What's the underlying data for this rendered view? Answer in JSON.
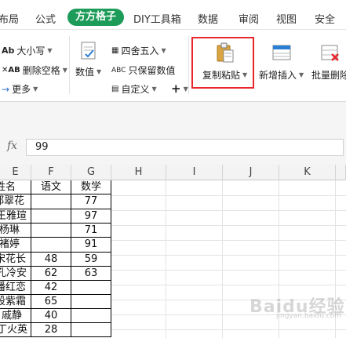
{
  "menu": {
    "tabs": [
      "布局",
      "公式",
      "方方格子",
      "DIY工具箱",
      "数据",
      "审阅",
      "视图",
      "安全"
    ],
    "active_tab": "方方格子"
  },
  "ribbon": {
    "uppercase": "大小写",
    "remove_spaces": "删除空格",
    "more": "更多",
    "numeric": "数值",
    "round": "四舍五入",
    "keep_numeric": "只保留数值",
    "custom": "自定义",
    "plus": "+",
    "copy_paste": "复制粘贴",
    "add_insert": "新增插入",
    "batch_delete": "批量删除"
  },
  "formula_bar": {
    "fx": "fx",
    "value": "99"
  },
  "columns": [
    "E",
    "F",
    "G",
    "H",
    "I",
    "J",
    "K"
  ],
  "rows": [
    {
      "name": "姓名",
      "chinese": "语文",
      "math": "数学"
    },
    {
      "name": "郑翠花",
      "chinese": "",
      "math": "77"
    },
    {
      "name": "王雅瑄",
      "chinese": "",
      "math": "97"
    },
    {
      "name": "杨琳",
      "chinese": "",
      "math": "71"
    },
    {
      "name": "褚婷",
      "chinese": "",
      "math": "91"
    },
    {
      "name": "宋花长",
      "chinese": "48",
      "math": "59"
    },
    {
      "name": "孔冷安",
      "chinese": "62",
      "math": "63"
    },
    {
      "name": "潘红恋",
      "chinese": "42",
      "math": ""
    },
    {
      "name": "段紫霜",
      "chinese": "65",
      "math": ""
    },
    {
      "name": "戚静",
      "chinese": "40",
      "math": ""
    },
    {
      "name": "丁火英",
      "chinese": "28",
      "math": ""
    }
  ],
  "watermark": "Baidu经验",
  "watermark_sub": "jingyan.baidu.com"
}
